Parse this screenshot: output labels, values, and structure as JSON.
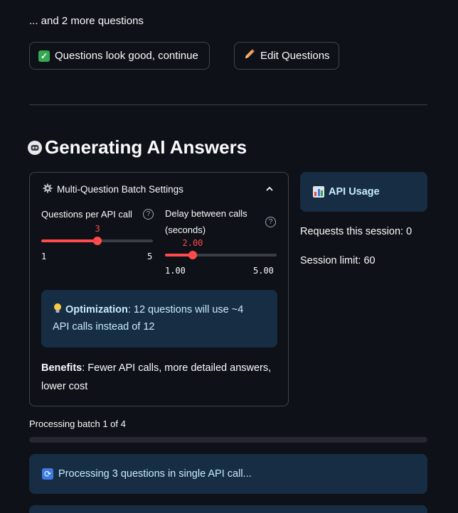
{
  "top": {
    "more_questions": "... and 2 more questions"
  },
  "buttons": {
    "continue_label": "Questions look good, continue",
    "edit_label": "Edit Questions"
  },
  "section": {
    "title": "Generating AI Answers"
  },
  "batch_settings": {
    "title": "Multi-Question Batch Settings",
    "questions_per_call": {
      "label": "Questions per API call",
      "value": "3",
      "min": "1",
      "max": "5",
      "fraction": 0.5
    },
    "delay": {
      "label_line1": "Delay between calls",
      "label_line2": "(seconds)",
      "value": "2.00",
      "min": "1.00",
      "max": "5.00",
      "fraction": 0.25
    },
    "optimization": {
      "bold": "Optimization",
      "line1": ": 12 questions will use ~4",
      "line2": "API calls instead of 12"
    },
    "benefits": {
      "bold": "Benefits",
      "line1": ": Fewer API calls, more detailed answers,",
      "line2": "lower cost"
    }
  },
  "api_usage": {
    "title": "API Usage",
    "requests": "Requests this session: 0",
    "limit": "Session limit: 60"
  },
  "progress": {
    "label": "Processing batch 1 of 4",
    "fraction": 0.0
  },
  "status": {
    "processing": "Processing 3 questions in single API call..."
  },
  "colors": {
    "accent": "#ff4b4b",
    "info_bg": "#172d43",
    "info_text": "#c7ebff",
    "background": "#0e1117"
  }
}
